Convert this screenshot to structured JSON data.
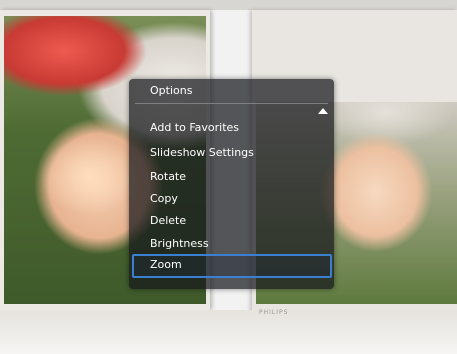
{
  "menu": {
    "title": "Options",
    "items": [
      {
        "label": "Add to Favorites"
      },
      {
        "label": "Slideshow Settings"
      },
      {
        "label": "Rotate"
      },
      {
        "label": "Copy"
      },
      {
        "label": "Delete"
      },
      {
        "label": "Brightness"
      },
      {
        "label": "Zoom"
      }
    ],
    "selected": "Zoom"
  },
  "frame": {
    "brand": "PHILIPS"
  },
  "colors": {
    "menu_background": "#16181c",
    "selection_border": "#3b7fd0",
    "text": "#ffffff"
  },
  "icons": {
    "scroll": "triangle-up"
  }
}
